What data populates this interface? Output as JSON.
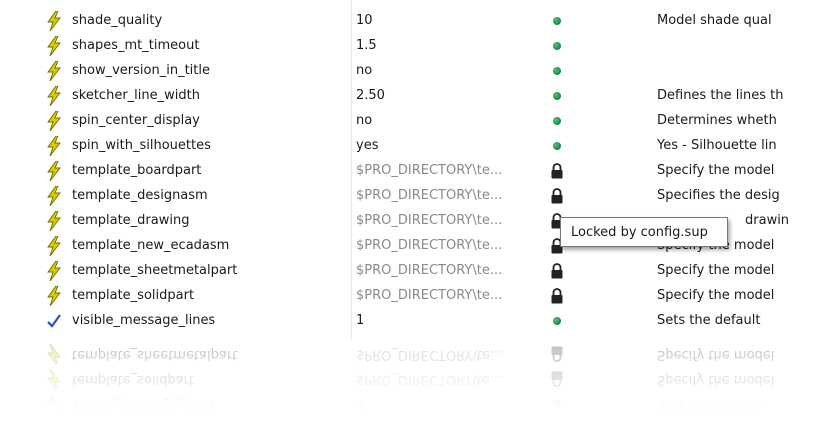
{
  "rows": [
    {
      "name": "shade_quality",
      "value": "10",
      "status": "default",
      "description": "Model shade qual",
      "icon": "lightning-icon"
    },
    {
      "name": "shapes_mt_timeout",
      "value": "1.5",
      "status": "default",
      "description": "",
      "icon": "lightning-icon"
    },
    {
      "name": "show_version_in_title",
      "value": "no",
      "status": "default",
      "description": "",
      "icon": "lightning-icon"
    },
    {
      "name": "sketcher_line_width",
      "value": "2.50",
      "status": "default",
      "description": "Defines the lines th",
      "icon": "lightning-icon"
    },
    {
      "name": "spin_center_display",
      "value": "no",
      "status": "default",
      "description": "Determines wheth",
      "icon": "lightning-icon"
    },
    {
      "name": "spin_with_silhouettes",
      "value": "yes",
      "status": "default",
      "description": "Yes - Silhouette lin",
      "icon": "lightning-icon"
    },
    {
      "name": "template_boardpart",
      "value": "$PRO_DIRECTORY\\te...",
      "status": "locked",
      "description": "Specify the model",
      "icon": "lightning-icon"
    },
    {
      "name": "template_designasm",
      "value": "$PRO_DIRECTORY\\te...",
      "status": "locked",
      "description": "Specifies the desig",
      "icon": "lightning-icon"
    },
    {
      "name": "template_drawing",
      "value": "$PRO_DIRECTORY\\te...",
      "status": "locked",
      "description": "drawin",
      "icon": "lightning-icon"
    },
    {
      "name": "template_new_ecadasm",
      "value": "$PRO_DIRECTORY\\te...",
      "status": "locked",
      "description": "Specify the model",
      "icon": "lightning-icon"
    },
    {
      "name": "template_sheetmetalpart",
      "value": "$PRO_DIRECTORY\\te...",
      "status": "locked",
      "description": "Specify the model",
      "icon": "lightning-icon"
    },
    {
      "name": "template_solidpart",
      "value": "$PRO_DIRECTORY\\te...",
      "status": "locked",
      "description": "Specify the model",
      "icon": "lightning-icon"
    },
    {
      "name": "visible_message_lines",
      "value": "1",
      "status": "default",
      "description": "Sets the default",
      "icon": "checkmark-icon"
    }
  ],
  "tooltip": {
    "text": "Locked by config.sup"
  },
  "colors": {
    "default_dot": "#1f8f47",
    "lightning": "#d8cc00",
    "lightning_outline": "#6b6b00",
    "checkmark": "#2a4fc6",
    "lock": "#222222",
    "locked_value": "#8a8a8a"
  }
}
